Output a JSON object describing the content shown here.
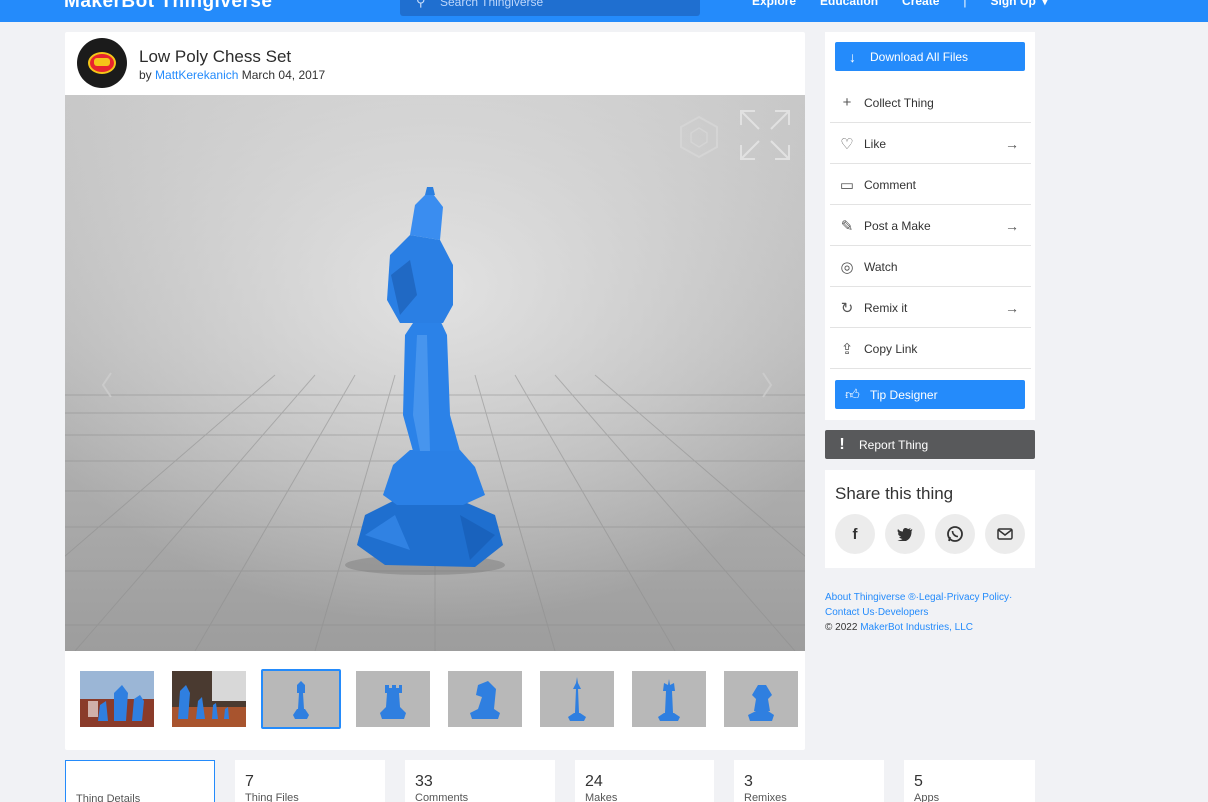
{
  "nav": {
    "logo": "MakerBot Thingiverse",
    "search_placeholder": "Search Thingiverse",
    "links": [
      "Explore",
      "Education",
      "Create"
    ],
    "separator": "|",
    "signup": "Sign Up",
    "signup_caret": "▾"
  },
  "thing": {
    "title": "Low Poly Chess Set",
    "by": "by",
    "author": "MattKerekanich",
    "date": "March 04, 2017"
  },
  "viewer": {
    "prev_icon": "chevron-left-icon",
    "next_icon": "chevron-right-icon",
    "piece_color": "#2f7fe0"
  },
  "thumbnails": {
    "count": 8,
    "selected_index": 2
  },
  "sidebar": {
    "download": "Download All Files",
    "actions": [
      {
        "label": "Collect Thing",
        "icon": "plus-icon",
        "arrow": false
      },
      {
        "label": "Like",
        "icon": "heart-icon",
        "arrow": true
      },
      {
        "label": "Comment",
        "icon": "comment-icon",
        "arrow": false
      },
      {
        "label": "Post a Make",
        "icon": "pencil-icon",
        "arrow": true
      },
      {
        "label": "Watch",
        "icon": "eye-icon",
        "arrow": false
      },
      {
        "label": "Remix it",
        "icon": "remix-icon",
        "arrow": true
      },
      {
        "label": "Copy Link",
        "icon": "share-icon",
        "arrow": false
      }
    ],
    "tip": "Tip Designer",
    "report": "Report Thing"
  },
  "share": {
    "title": "Share this thing",
    "buttons": [
      "facebook-icon",
      "twitter-icon",
      "whatsapp-icon",
      "email-icon"
    ]
  },
  "footer": {
    "about": "About Thingiverse ®",
    "legal": "Legal",
    "privacy": "Privacy Policy",
    "contact": "Contact Us",
    "developers": "Developers",
    "copyright": "©  2022",
    "company": "MakerBot Industries, LLC"
  },
  "stats": [
    {
      "num": "",
      "label": "Thing Details"
    },
    {
      "num": "7",
      "label": "Thing Files"
    },
    {
      "num": "33",
      "label": "Comments"
    },
    {
      "num": "24",
      "label": "Makes"
    },
    {
      "num": "3",
      "label": "Remixes"
    },
    {
      "num": "5",
      "label": "Apps"
    }
  ],
  "colors": {
    "brand": "#248bfb",
    "report": "#58595b"
  }
}
